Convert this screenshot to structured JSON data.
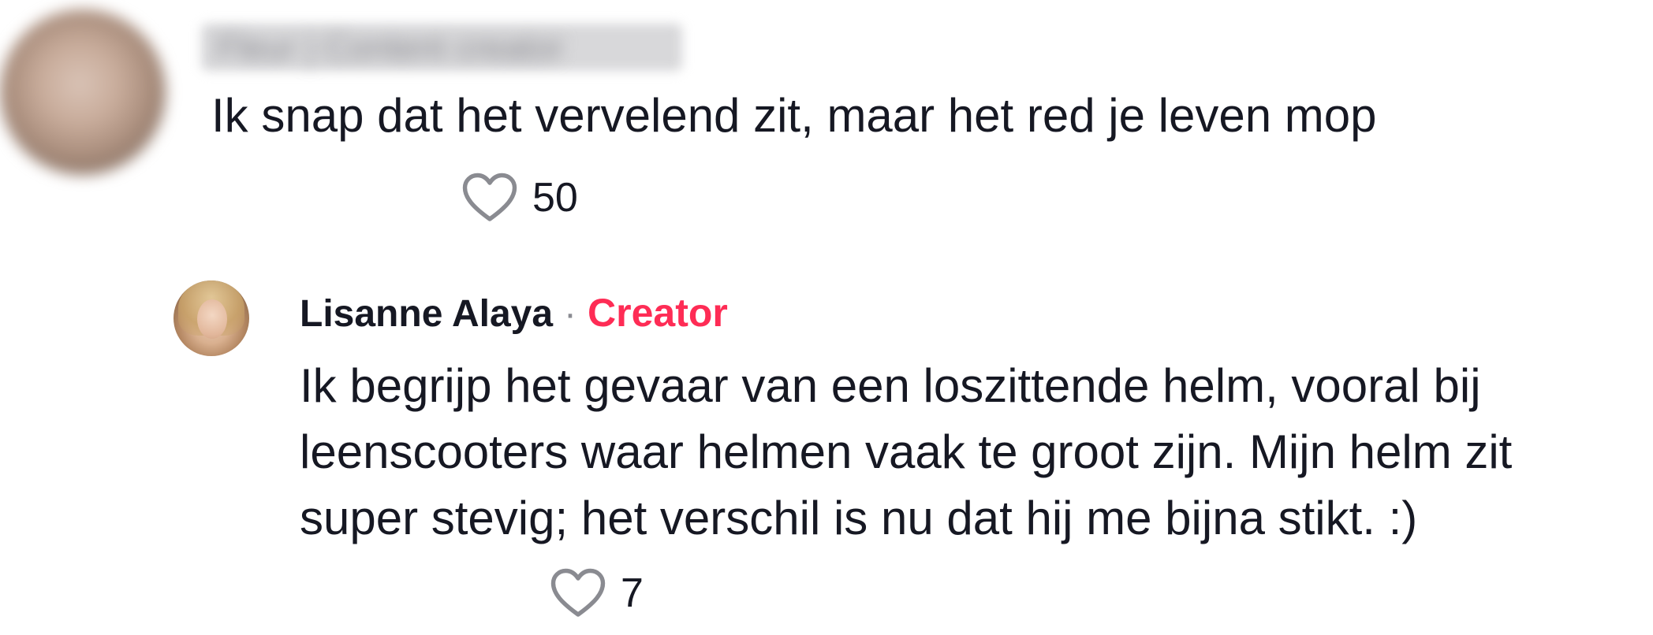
{
  "comments": [
    {
      "username": "Fleur | Content creator",
      "text": "Ik snap dat het vervelend zit, maar het red je leven mop",
      "likes": "50",
      "icons": {
        "like": "heart-outline-icon"
      }
    }
  ],
  "reply": {
    "author": "Lisanne Alaya",
    "separator": "·",
    "badge": "Creator",
    "text": "Ik begrijp het gevaar van een loszittende helm, vooral bij leenscooters waar helmen vaak te groot zijn. Mijn helm zit super stevig; het verschil is nu dat hij me bijna stikt. :)",
    "likes": "7",
    "icons": {
      "like": "heart-outline-icon"
    }
  },
  "colors": {
    "text": "#161823",
    "creator_badge": "#fe2c55",
    "separator": "#8a8b91",
    "icon_stroke": "#8a8b91"
  }
}
